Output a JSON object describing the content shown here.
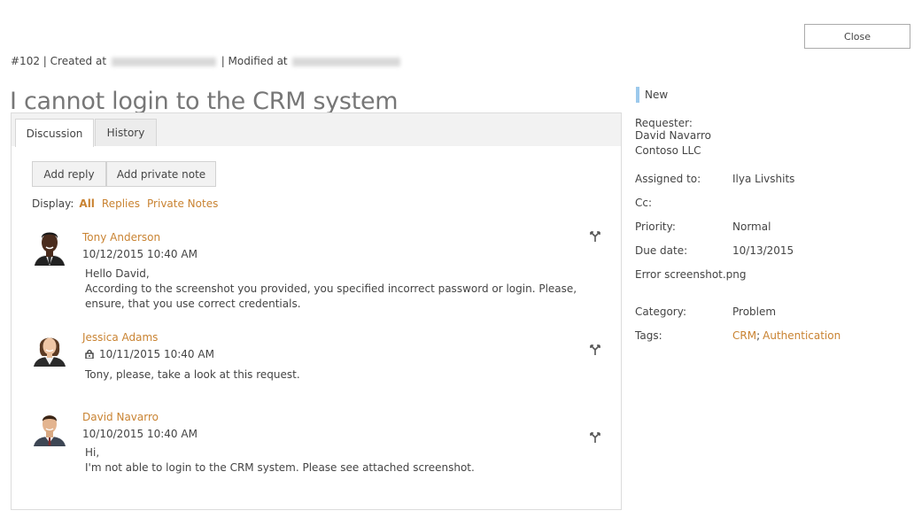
{
  "header": {
    "close_label": "Close",
    "ticket_id": "#102",
    "created_label": "| Created at",
    "modified_label": "| Modified at",
    "title": "I cannot login to the CRM system"
  },
  "tabs": [
    {
      "label": "Discussion",
      "active": true
    },
    {
      "label": "History",
      "active": false
    }
  ],
  "actions": {
    "add_reply": "Add reply",
    "add_private_note": "Add private note"
  },
  "display_filter": {
    "label": "Display:",
    "options": [
      "All",
      "Replies",
      "Private Notes"
    ],
    "selected": "All"
  },
  "messages": [
    {
      "author": "Tony Anderson",
      "date": "10/12/2015 10:40 AM",
      "private": false,
      "lines": [
        "Hello David,",
        "According to the screenshot you provided, you specified incorrect password or login. Please, ensure, that you use correct credentials."
      ]
    },
    {
      "author": "Jessica Adams",
      "date": "10/11/2015 10:40 AM",
      "private": true,
      "lines": [
        "Tony, please, take a look at this request."
      ]
    },
    {
      "author": "David Navarro",
      "date": "10/10/2015 10:40 AM",
      "private": false,
      "lines": [
        "Hi,",
        "I'm not able to login to the CRM system. Please see attached screenshot."
      ]
    }
  ],
  "sidebar": {
    "status": "New",
    "status_color": "#9cc9ec",
    "requester_label": "Requester:",
    "requester_name": "David Navarro",
    "requester_company": "Contoso LLC",
    "assigned_label": "Assigned to:",
    "assigned_value": "Ilya Livshits",
    "cc_label": "Cc:",
    "priority_label": "Priority:",
    "priority_value": "Normal",
    "due_label": "Due date:",
    "due_value": "10/13/2015",
    "attachment": "Error screenshot.png",
    "category_label": "Category:",
    "category_value": "Problem",
    "tags_label": "Tags:",
    "tags": [
      "CRM",
      "Authentication"
    ],
    "tag_separator": ";"
  },
  "colors": {
    "link": "#c98332",
    "text": "#444444",
    "title": "#777777"
  }
}
